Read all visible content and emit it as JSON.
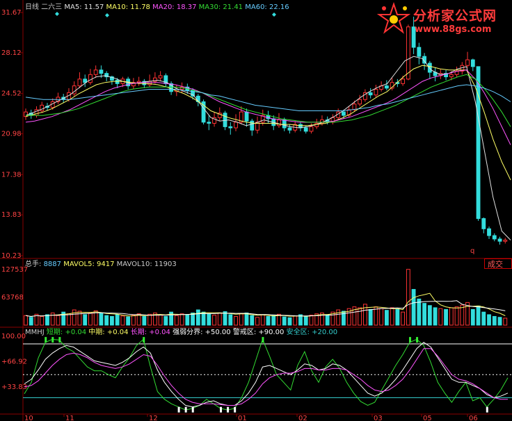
{
  "price_panel": {
    "period": "日线",
    "indicator": "二六三",
    "ma_legend": [
      {
        "label": "MA5: 11.57",
        "color": "#e0e0e0"
      },
      {
        "label": "MA10: 11.78",
        "color": "#ffff66"
      },
      {
        "label": "MA20: 18.37",
        "color": "#ff55ff"
      },
      {
        "label": "MA30: 21.41",
        "color": "#33dd33"
      },
      {
        "label": "MA60: 22.16",
        "color": "#66ccff"
      }
    ],
    "y_ticks": [
      "31.67",
      "28.12",
      "24.52",
      "20.98",
      "17.38",
      "13.83",
      "10.23"
    ]
  },
  "volume_panel": {
    "legend": [
      {
        "label": "总手: ",
        "color": "#cccccc"
      },
      {
        "label": "8887",
        "color": "#66ccff"
      },
      {
        "label": "  MAVOL5: ",
        "color": "#ffff66"
      },
      {
        "label": "9417",
        "color": "#ffff66"
      },
      {
        "label": "  MAVOL10: ",
        "color": "#cccccc"
      },
      {
        "label": "11903",
        "color": "#cccccc"
      }
    ],
    "y_ticks": [
      "127537",
      "63768"
    ],
    "button_label": "成交"
  },
  "indicator_panel": {
    "legend": [
      {
        "label": "MMHJ",
        "color": "#cccccc"
      },
      {
        "label": " 短期: ",
        "color": "#33dd33"
      },
      {
        "label": "+0.04",
        "color": "#33dd33"
      },
      {
        "label": "  中期: ",
        "color": "#ffff66"
      },
      {
        "label": "+0.04",
        "color": "#ffff66"
      },
      {
        "label": "  长期: ",
        "color": "#ff55ff"
      },
      {
        "label": "+0.04",
        "color": "#ff55ff"
      },
      {
        "label": "  强弱分界: ",
        "color": "#ffffff"
      },
      {
        "label": "+50.00",
        "color": "#ffffff"
      },
      {
        "label": "  警戒区: ",
        "color": "#ffffff"
      },
      {
        "label": "+90.00",
        "color": "#ffffff"
      },
      {
        "label": "  安全区: ",
        "color": "#33cccc"
      },
      {
        "label": "+20.00",
        "color": "#33cccc"
      }
    ],
    "y_ticks": [
      "100.00",
      "+66.92",
      "+33.83"
    ]
  },
  "x_axis": {
    "ticks": [
      "10",
      "11",
      "12",
      "01",
      "02",
      "03",
      "05",
      "06"
    ]
  },
  "watermark": {
    "title": "分析家公式网",
    "url": "www.88gs.com"
  },
  "chart_data": {
    "type": "candlestick",
    "price_ylim": [
      10.23,
      31.67
    ],
    "volume_ylim": [
      0,
      127537
    ],
    "indicator_ylim": [
      0.5,
      100
    ],
    "indicator_levels": {
      "upper": 90,
      "middle": 50,
      "lower": 20
    },
    "n_bars": 144,
    "candles": [
      [
        22.5,
        22.9,
        23.2,
        22.2
      ],
      [
        22.8,
        22.6,
        23.1,
        22.3
      ],
      [
        22.6,
        23.1,
        23.4,
        22.4
      ],
      [
        23.0,
        23.5,
        23.8,
        22.8
      ],
      [
        23.4,
        23.3,
        23.7,
        23.0
      ],
      [
        23.3,
        23.8,
        24.1,
        23.1
      ],
      [
        23.8,
        24.2,
        24.6,
        23.6
      ],
      [
        24.2,
        24.0,
        24.5,
        23.7
      ],
      [
        24.0,
        24.6,
        25.0,
        23.8
      ],
      [
        24.5,
        25.2,
        25.6,
        24.3
      ],
      [
        25.2,
        25.8,
        26.4,
        25.0
      ],
      [
        25.8,
        25.5,
        26.2,
        25.1
      ],
      [
        25.5,
        26.2,
        26.7,
        25.3
      ],
      [
        26.2,
        26.6,
        27.0,
        25.9
      ],
      [
        26.6,
        26.3,
        27.0,
        25.9
      ],
      [
        26.3,
        26.0,
        26.5,
        25.6
      ],
      [
        26.0,
        25.7,
        26.1,
        25.3
      ],
      [
        25.7,
        25.4,
        25.9,
        25.0
      ],
      [
        25.4,
        25.8,
        26.0,
        25.1
      ],
      [
        25.8,
        25.2,
        26.0,
        24.9
      ],
      [
        25.2,
        25.5,
        25.9,
        24.9
      ],
      [
        25.5,
        25.6,
        26.0,
        25.2
      ],
      [
        25.6,
        25.3,
        25.8,
        25.0
      ],
      [
        25.3,
        25.6,
        26.2,
        25.1
      ],
      [
        25.6,
        25.9,
        26.4,
        25.4
      ],
      [
        25.9,
        26.1,
        26.5,
        25.6
      ],
      [
        26.1,
        25.4,
        26.3,
        25.1
      ],
      [
        25.4,
        24.7,
        25.6,
        24.4
      ],
      [
        24.7,
        24.9,
        25.3,
        24.3
      ],
      [
        24.9,
        25.1,
        25.5,
        24.6
      ],
      [
        25.1,
        24.8,
        25.4,
        24.5
      ],
      [
        24.8,
        24.3,
        25.0,
        24.0
      ],
      [
        24.3,
        23.8,
        24.5,
        23.4
      ],
      [
        23.8,
        22.0,
        24.0,
        21.8
      ],
      [
        22.0,
        21.9,
        22.6,
        21.3
      ],
      [
        21.9,
        22.4,
        22.9,
        21.6
      ],
      [
        22.4,
        22.8,
        23.3,
        22.1
      ],
      [
        22.8,
        21.6,
        23.0,
        21.3
      ],
      [
        21.6,
        21.5,
        22.0,
        20.9
      ],
      [
        21.5,
        22.0,
        22.7,
        21.2
      ],
      [
        22.0,
        22.9,
        23.4,
        21.8
      ],
      [
        22.9,
        22.1,
        23.2,
        21.6
      ],
      [
        22.1,
        21.3,
        22.3,
        20.8
      ],
      [
        21.3,
        22.0,
        22.5,
        21.0
      ],
      [
        22.0,
        22.6,
        23.1,
        21.7
      ],
      [
        22.6,
        22.3,
        23.0,
        21.9
      ],
      [
        22.3,
        21.7,
        22.6,
        21.3
      ],
      [
        21.7,
        22.2,
        22.8,
        21.5
      ],
      [
        22.2,
        21.5,
        22.4,
        21.2
      ],
      [
        21.5,
        21.3,
        21.8,
        21.0
      ],
      [
        21.3,
        21.8,
        22.1,
        21.1
      ],
      [
        21.8,
        21.5,
        22.0,
        21.2
      ],
      [
        21.5,
        21.2,
        21.7,
        21.0
      ],
      [
        21.2,
        21.6,
        21.9,
        21.0
      ],
      [
        21.6,
        21.9,
        22.3,
        21.4
      ],
      [
        21.9,
        22.2,
        22.6,
        21.7
      ],
      [
        22.2,
        22.0,
        22.5,
        21.8
      ],
      [
        22.0,
        22.4,
        22.7,
        21.8
      ],
      [
        22.4,
        22.9,
        23.2,
        22.2
      ],
      [
        22.9,
        22.6,
        23.1,
        22.3
      ],
      [
        22.6,
        23.1,
        23.4,
        22.4
      ],
      [
        23.1,
        23.6,
        23.9,
        22.9
      ],
      [
        23.6,
        24.0,
        24.4,
        23.4
      ],
      [
        24.0,
        24.6,
        24.9,
        23.8
      ],
      [
        24.6,
        24.4,
        25.0,
        24.1
      ],
      [
        24.4,
        24.9,
        25.3,
        24.2
      ],
      [
        24.9,
        25.2,
        25.6,
        24.7
      ],
      [
        25.2,
        25.0,
        25.7,
        24.8
      ],
      [
        25.0,
        25.5,
        25.9,
        24.8
      ],
      [
        25.5,
        25.4,
        25.8,
        25.1
      ],
      [
        25.4,
        25.8,
        26.1,
        25.2
      ],
      [
        25.8,
        30.4,
        30.6,
        25.7
      ],
      [
        30.4,
        28.6,
        31.3,
        28.0
      ],
      [
        28.6,
        27.8,
        29.0,
        27.1
      ],
      [
        27.8,
        27.2,
        28.1,
        26.6
      ],
      [
        27.2,
        26.4,
        27.4,
        25.8
      ],
      [
        26.4,
        26.1,
        26.8,
        25.6
      ],
      [
        26.1,
        26.3,
        26.7,
        25.8
      ],
      [
        26.3,
        26.0,
        26.6,
        25.7
      ],
      [
        26.0,
        26.2,
        26.5,
        25.7
      ],
      [
        26.2,
        26.5,
        26.9,
        26.0
      ],
      [
        26.5,
        27.0,
        27.3,
        26.2
      ],
      [
        27.0,
        27.5,
        28.2,
        26.8
      ],
      [
        27.5,
        26.9,
        27.6,
        26.5
      ],
      [
        26.9,
        13.5,
        14.0,
        13.3
      ],
      [
        13.5,
        12.6,
        13.6,
        12.2
      ],
      [
        12.6,
        12.0,
        12.8,
        11.7
      ],
      [
        12.0,
        11.7,
        12.2,
        11.5
      ],
      [
        11.7,
        11.5,
        11.9,
        11.2
      ],
      [
        11.5,
        11.6,
        11.8,
        11.3
      ]
    ],
    "volume": [
      22,
      18,
      25,
      20,
      24,
      28,
      22,
      30,
      26,
      35,
      32,
      24,
      28,
      33,
      27,
      22,
      20,
      24,
      21,
      19,
      23,
      26,
      20,
      25,
      28,
      24,
      20,
      30,
      22,
      26,
      24,
      28,
      35,
      30,
      26,
      23,
      28,
      31,
      24,
      20,
      26,
      28,
      22,
      18,
      24,
      20,
      22,
      25,
      19,
      17,
      21,
      24,
      20,
      23,
      26,
      28,
      24,
      30,
      35,
      32,
      38,
      42,
      40,
      48,
      36,
      42,
      38,
      34,
      40,
      36,
      30,
      128,
      82,
      60,
      50,
      45,
      40,
      38,
      36,
      40,
      42,
      46,
      52,
      36,
      44,
      30,
      24,
      20,
      18,
      16
    ],
    "series": [
      {
        "name": "短期",
        "values": [
          25,
          40,
          72,
          92,
          96,
          95,
          85,
          80,
          70,
          60,
          55,
          55,
          50,
          46,
          60,
          72,
          88,
          96,
          60,
          28,
          18,
          12,
          8,
          4,
          6,
          10,
          18,
          12,
          6,
          4,
          6,
          20,
          40,
          68,
          96,
          74,
          50,
          40,
          30,
          62,
          80,
          55,
          40,
          60,
          70,
          58,
          40,
          26,
          15,
          10,
          14,
          30,
          46,
          62,
          76,
          92,
          96,
          88,
          66,
          40,
          26,
          14,
          28,
          40,
          16,
          20,
          8,
          18,
          30,
          46
        ]
      },
      {
        "name": "中期",
        "values": [
          38,
          44,
          56,
          70,
          78,
          84,
          88,
          86,
          80,
          74,
          68,
          66,
          64,
          62,
          66,
          72,
          80,
          86,
          78,
          56,
          40,
          28,
          18,
          10,
          8,
          10,
          14,
          16,
          12,
          10,
          10,
          16,
          26,
          40,
          60,
          62,
          58,
          54,
          50,
          56,
          64,
          62,
          56,
          58,
          64,
          62,
          56,
          46,
          36,
          26,
          22,
          26,
          34,
          44,
          56,
          70,
          84,
          92,
          86,
          72,
          58,
          44,
          40,
          40,
          36,
          32,
          24,
          20,
          22,
          26
        ]
      },
      {
        "name": "长期",
        "values": [
          34,
          36,
          42,
          52,
          62,
          70,
          76,
          78,
          76,
          72,
          66,
          62,
          60,
          58,
          60,
          64,
          70,
          76,
          74,
          62,
          48,
          36,
          26,
          18,
          14,
          12,
          12,
          12,
          11,
          10,
          10,
          12,
          18,
          26,
          38,
          46,
          50,
          52,
          52,
          54,
          58,
          58,
          56,
          56,
          58,
          58,
          56,
          50,
          44,
          36,
          30,
          28,
          30,
          36,
          44,
          56,
          70,
          84,
          84,
          74,
          62,
          50,
          44,
          42,
          38,
          32,
          26,
          20,
          18,
          18
        ]
      }
    ],
    "ma_lines": [
      {
        "name": "MA5",
        "values": [
          22.6,
          22.9,
          23.2,
          23.6,
          24.0,
          24.4,
          25.0,
          25.6,
          26.0,
          26.1,
          25.9,
          25.6,
          25.4,
          25.5,
          25.6,
          25.7,
          25.5,
          25.0,
          24.7,
          24.4,
          23.4,
          22.4,
          22.1,
          22.2,
          22.0,
          21.7,
          21.9,
          22.2,
          22.0,
          21.8,
          21.6,
          21.5,
          21.6,
          21.8,
          22.1,
          22.5,
          23.0,
          23.6,
          24.2,
          24.7,
          25.1,
          25.4,
          26.4,
          27.4,
          27.8,
          27.6,
          26.6,
          26.2,
          26.3,
          26.7,
          26.9,
          23.8,
          19.6,
          15.4,
          12.4,
          11.6
        ]
      },
      {
        "name": "MA10",
        "values": [
          22.5,
          22.7,
          22.9,
          23.2,
          23.6,
          24.0,
          24.5,
          24.9,
          25.3,
          25.5,
          25.6,
          25.6,
          25.5,
          25.4,
          25.4,
          25.3,
          25.1,
          24.8,
          24.5,
          24.1,
          23.6,
          23.0,
          22.7,
          22.4,
          22.2,
          22.0,
          21.9,
          21.9,
          21.9,
          21.8,
          21.8,
          21.7,
          21.7,
          21.8,
          21.9,
          22.1,
          22.4,
          22.8,
          23.3,
          23.8,
          24.3,
          24.7,
          25.4,
          26.1,
          26.7,
          27.0,
          26.9,
          26.7,
          26.6,
          26.6,
          26.6,
          25.1,
          22.9,
          20.5,
          18.5,
          16.9
        ]
      },
      {
        "name": "MA20",
        "values": [
          22.0,
          22.1,
          22.3,
          22.5,
          22.8,
          23.1,
          23.5,
          23.9,
          24.3,
          24.7,
          25.0,
          25.2,
          25.4,
          25.5,
          25.5,
          25.5,
          25.4,
          25.3,
          25.1,
          24.9,
          24.6,
          24.2,
          23.8,
          23.5,
          23.2,
          22.9,
          22.7,
          22.5,
          22.3,
          22.2,
          22.1,
          22.0,
          22.0,
          22.0,
          22.0,
          22.1,
          22.3,
          22.5,
          22.8,
          23.1,
          23.4,
          23.7,
          24.1,
          24.6,
          25.1,
          25.6,
          25.9,
          26.1,
          26.3,
          26.5,
          26.6,
          25.8,
          24.6,
          23.2,
          21.6,
          20.0
        ]
      },
      {
        "name": "MA30",
        "values": [
          22.6,
          22.6,
          22.6,
          22.7,
          22.8,
          23.0,
          23.2,
          23.5,
          23.8,
          24.1,
          24.4,
          24.7,
          24.9,
          25.0,
          25.1,
          25.1,
          25.1,
          25.1,
          25.0,
          24.8,
          24.6,
          24.3,
          24.0,
          23.7,
          23.4,
          23.1,
          22.9,
          22.7,
          22.5,
          22.3,
          22.2,
          22.1,
          22.0,
          22.0,
          22.0,
          22.0,
          22.1,
          22.2,
          22.4,
          22.6,
          22.9,
          23.2,
          23.5,
          23.9,
          24.3,
          24.7,
          25.1,
          25.4,
          25.7,
          26.0,
          26.2,
          25.8,
          25.0,
          24.0,
          22.9,
          21.6
        ]
      },
      {
        "name": "MA60",
        "values": [
          24.2,
          24.1,
          24.0,
          24.0,
          24.0,
          24.0,
          24.1,
          24.2,
          24.3,
          24.4,
          24.5,
          24.6,
          24.7,
          24.8,
          24.9,
          24.9,
          24.9,
          24.9,
          24.8,
          24.7,
          24.6,
          24.4,
          24.3,
          24.1,
          23.9,
          23.7,
          23.5,
          23.4,
          23.3,
          23.2,
          23.1,
          23.0,
          23.0,
          23.0,
          23.0,
          23.0,
          23.0,
          23.1,
          23.2,
          23.3,
          23.5,
          23.6,
          23.8,
          24.0,
          24.2,
          24.4,
          24.6,
          24.8,
          25.0,
          25.2,
          25.3,
          25.2,
          25.0,
          24.7,
          24.3,
          23.8
        ]
      }
    ]
  }
}
